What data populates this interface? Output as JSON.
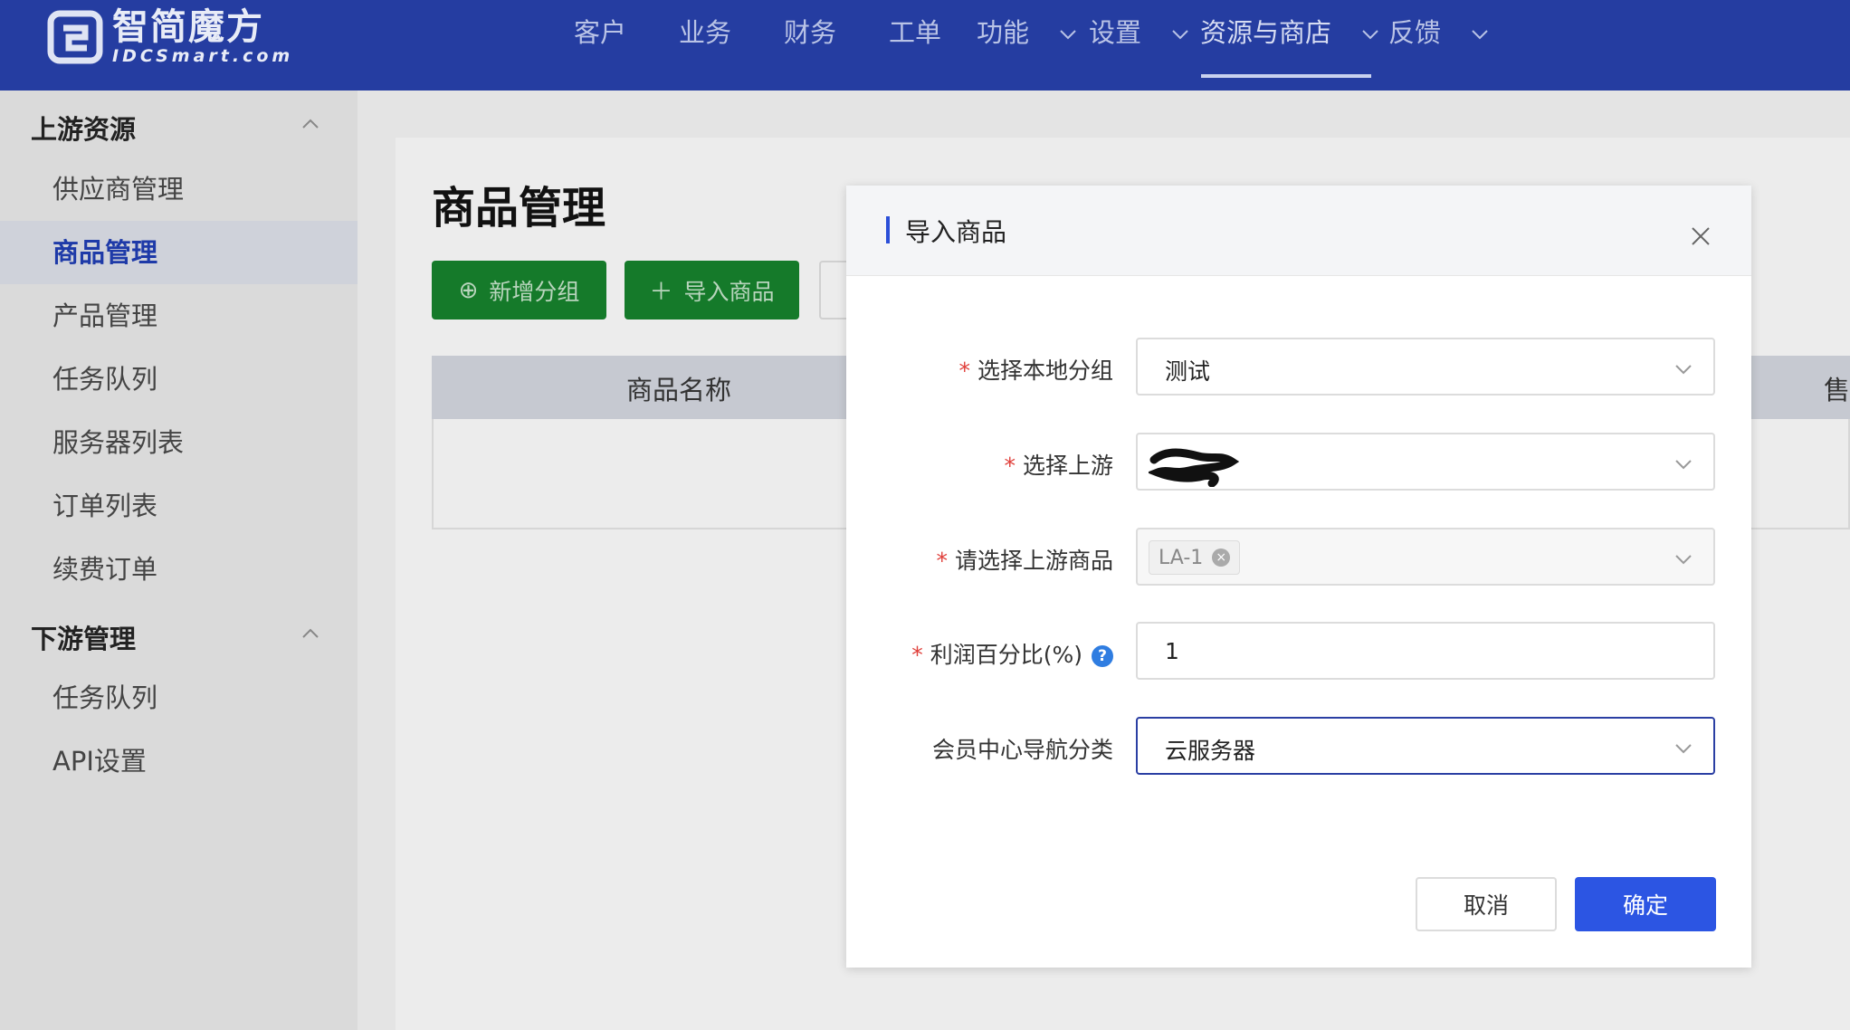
{
  "brand": {
    "name_cn": "智简魔方",
    "name_en": "IDCSmart.com"
  },
  "nav": {
    "items": [
      {
        "label": "客户"
      },
      {
        "label": "业务"
      },
      {
        "label": "财务"
      },
      {
        "label": "工单"
      },
      {
        "label": "功能"
      },
      {
        "label": "设置"
      },
      {
        "label": "资源与商店"
      },
      {
        "label": "反馈"
      }
    ],
    "active": "资源与商店"
  },
  "sidebar": {
    "groups": [
      {
        "title": "上游资源",
        "items": [
          {
            "label": "供应商管理"
          },
          {
            "label": "商品管理"
          },
          {
            "label": "产品管理"
          },
          {
            "label": "任务队列"
          },
          {
            "label": "服务器列表"
          },
          {
            "label": "订单列表"
          },
          {
            "label": "续费订单"
          }
        ]
      },
      {
        "title": "下游管理",
        "items": [
          {
            "label": "任务队列"
          },
          {
            "label": "API设置"
          }
        ]
      }
    ],
    "active_item": "商品管理"
  },
  "page": {
    "title": "商品管理",
    "buttons": {
      "add_group": "新增分组",
      "import_product": "导入商品"
    },
    "table": {
      "columns": [
        "商品名称",
        "售"
      ]
    }
  },
  "modal": {
    "title": "导入商品",
    "fields": {
      "local_group": {
        "label": "选择本地分组",
        "required": true,
        "value": "测试"
      },
      "upstream": {
        "label": "选择上游",
        "required": true,
        "value": ""
      },
      "upstream_product": {
        "label": "请选择上游商品",
        "required": true,
        "tag": "LA-1"
      },
      "profit_percent": {
        "label": "利润百分比(%)",
        "required": true,
        "value": "1",
        "help": "?"
      },
      "member_nav": {
        "label": "会员中心导航分类",
        "required": false,
        "value": "云服务器"
      }
    },
    "buttons": {
      "cancel": "取消",
      "confirm": "确定"
    }
  },
  "colors": {
    "topbar": "#253da1",
    "primary": "#2c55e3",
    "green": "#157a2a",
    "required": "#e0403b",
    "sidebar_active": "#1e3aa8"
  }
}
